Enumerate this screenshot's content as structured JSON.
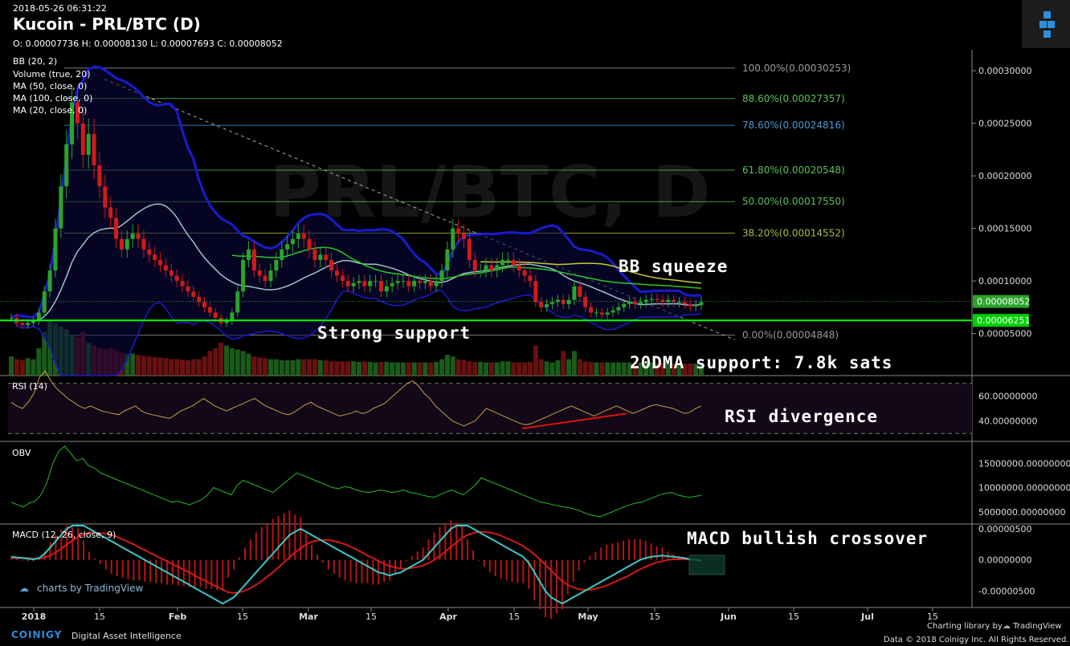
{
  "header": {
    "timestamp": "2018-05-26 06:31:22",
    "title": "Kucoin - PRL/BTC (D)",
    "ohlc": "O: 0.00007736 H: 0.00008130 L: 0.00007693 C: 0.00008052"
  },
  "indicators": [
    "BB (20, 2)",
    "Volume (true, 20)",
    "MA (50, close, 0)",
    "MA (100, close, 0)",
    "MA (20, close, 0)"
  ],
  "watermark": "PRL/BTC, D",
  "annotations": {
    "bb_squeeze": "BB squeeze",
    "strong_support": "Strong support",
    "dma_support": "20DMA support: 7.8k sats",
    "rsi_divergence": "RSI divergence",
    "macd_crossover": "MACD bullish crossover"
  },
  "footer": {
    "tv_badge": "charts by TradingView",
    "coinigy": "COINIGY",
    "coinigy_tag": "Digital Asset Intelligence",
    "charting_lib": "Charting library by",
    "tradingview": "TradingView",
    "copyright": "Data © 2018 Coinigy Inc. All Rights Reserved."
  },
  "colors": {
    "up": "#2aa52a",
    "down": "#d21a1a",
    "bb": "#1a1ad0",
    "ma20": "#9fc3c8",
    "ma50": "#2ac82a",
    "ma100": "#c8c83a",
    "support": "#00ff00",
    "rsi": "#c8a040",
    "obv": "#2ab82a",
    "macd": "#3ac8c8",
    "signal": "#d21a1a"
  },
  "chart_data": [
    {
      "type": "candlestick",
      "panel": "price",
      "x_ticks": [
        "2018",
        "15",
        "Feb",
        "15",
        "Mar",
        "15",
        "Apr",
        "15",
        "May",
        "15",
        "Jun",
        "15",
        "Jul",
        "15"
      ],
      "ylim": [
        1e-05,
        0.00032
      ],
      "y_ticks": [
        "0.00005000",
        "0.00010000",
        "0.00015000",
        "0.00020000",
        "0.00025000",
        "0.00030000"
      ],
      "last_close_label": "0.00008052",
      "last_close": 8.052e-05,
      "support_label": "0.00006251",
      "support": 6.251e-05,
      "fib_levels": [
        {
          "label": "100.00%(0.00030253)",
          "value": 0.00030253
        },
        {
          "label": "88.60%(0.00027357)",
          "value": 0.00027357
        },
        {
          "label": "78.60%(0.00024816)",
          "value": 0.00024816
        },
        {
          "label": "61.80%(0.00020548)",
          "value": 0.00020548
        },
        {
          "label": "50.00%(0.00017550)",
          "value": 0.0001755
        },
        {
          "label": "38.20%(0.00014552)",
          "value": 0.00014552
        },
        {
          "label": "0.00%(0.00004848)",
          "value": 4.848e-05
        }
      ],
      "close": [
        6.5e-05,
        6e-05,
        5.8e-05,
        6e-05,
        6.2e-05,
        7e-05,
        9e-05,
        0.00011,
        0.00015,
        0.00019,
        0.00023,
        0.00027,
        0.00025,
        0.00022,
        0.00024,
        0.00021,
        0.00019,
        0.00017,
        0.00016,
        0.00014,
        0.00013,
        0.00014,
        0.000145,
        0.00014,
        0.00013,
        0.000125,
        0.00012,
        0.000115,
        0.00011,
        0.000105,
        0.0001,
        9.5e-05,
        9e-05,
        8.5e-05,
        8e-05,
        7.5e-05,
        7e-05,
        6.5e-05,
        6e-05,
        6.2e-05,
        7e-05,
        9e-05,
        0.00012,
        0.00013,
        0.00011,
        0.000105,
        0.0001,
        0.00011,
        0.00012,
        0.00013,
        0.000135,
        0.00014,
        0.000145,
        0.00014,
        0.00013,
        0.00012,
        0.000125,
        0.00012,
        0.00011,
        0.000105,
        0.0001,
        9.5e-05,
        9.8e-05,
        0.0001,
        9.5e-05,
        0.0001,
        0.0001,
        9e-05,
        9.5e-05,
        9.8e-05,
        0.0001,
        0.0001,
        9.5e-05,
        0.0001,
        9.8e-05,
        0.0001,
        9.5e-05,
        0.0001,
        0.00011,
        0.00013,
        0.00015,
        0.000145,
        0.00014,
        0.00012,
        0.00011,
        0.00011,
        0.000115,
        0.00011,
        0.000115,
        0.00012,
        0.00012,
        0.000115,
        0.00011,
        0.000105,
        0.0001,
        8e-05,
        7.5e-05,
        7.8e-05,
        8e-05,
        8.2e-05,
        7.8e-05,
        8.2e-05,
        9.5e-05,
        8.5e-05,
        7.5e-05,
        7e-05,
        7e-05,
        6.8e-05,
        7e-05,
        7.2e-05,
        7.5e-05,
        7.8e-05,
        8e-05,
        7.8e-05,
        8e-05,
        8.2e-05,
        8.3e-05,
        8.2e-05,
        8e-05,
        8.2e-05,
        8e-05,
        8e-05,
        7.8e-05,
        7.6e-05,
        7.7e-05,
        8e-05
      ]
    },
    {
      "type": "bar",
      "panel": "volume",
      "values": [
        0.35,
        0.3,
        0.28,
        0.32,
        0.3,
        0.5,
        0.8,
        1,
        0.95,
        0.9,
        0.85,
        0.75,
        0.7,
        0.8,
        0.6,
        0.55,
        0.5,
        0.48,
        0.5,
        0.45,
        0.42,
        0.4,
        0.4,
        0.38,
        0.36,
        0.35,
        0.34,
        0.33,
        0.32,
        0.3,
        0.3,
        0.29,
        0.28,
        0.3,
        0.3,
        0.35,
        0.45,
        0.5,
        0.6,
        0.55,
        0.5,
        0.48,
        0.45,
        0.4,
        0.35,
        0.33,
        0.32,
        0.3,
        0.3,
        0.28,
        0.28,
        0.28,
        0.3,
        0.3,
        0.3,
        0.3,
        0.28,
        0.28,
        0.26,
        0.26,
        0.26,
        0.26,
        0.26,
        0.25,
        0.26,
        0.25,
        0.24,
        0.25,
        0.25,
        0.24,
        0.24,
        0.24,
        0.24,
        0.24,
        0.24,
        0.24,
        0.24,
        0.25,
        0.3,
        0.38,
        0.35,
        0.3,
        0.28,
        0.26,
        0.25,
        0.25,
        0.24,
        0.24,
        0.24,
        0.26,
        0.26,
        0.24,
        0.24,
        0.24,
        0.25,
        0.55,
        0.3,
        0.26,
        0.24,
        0.28,
        0.45,
        0.3,
        0.45,
        0.3,
        0.26,
        0.25,
        0.24,
        0.24,
        0.24,
        0.24,
        0.24,
        0.24,
        0.24,
        0.24,
        0.24,
        0.24,
        0.24,
        0.22,
        0.22,
        0.22,
        0.22,
        0.22,
        0.22,
        0.22,
        0.22,
        0.22
      ]
    },
    {
      "type": "line",
      "panel": "rsi",
      "title": "RSI (14)",
      "y_ticks": [
        "60.00000000",
        "40.00000000"
      ],
      "ylim": [
        25,
        75
      ],
      "values": [
        55,
        52,
        50,
        55,
        62,
        75,
        80,
        72,
        66,
        62,
        58,
        55,
        52,
        50,
        52,
        50,
        48,
        47,
        46,
        45,
        48,
        50,
        52,
        48,
        46,
        45,
        44,
        43,
        42,
        45,
        48,
        50,
        52,
        55,
        58,
        55,
        52,
        50,
        48,
        50,
        52,
        54,
        56,
        58,
        55,
        52,
        50,
        48,
        46,
        45,
        47,
        50,
        53,
        55,
        52,
        50,
        48,
        46,
        44,
        45,
        46,
        48,
        46,
        47,
        50,
        52,
        54,
        58,
        62,
        66,
        70,
        72,
        68,
        62,
        58,
        52,
        48,
        44,
        40,
        38,
        36,
        38,
        40,
        45,
        50,
        48,
        46,
        44,
        42,
        40,
        38,
        37,
        38,
        40,
        42,
        44,
        46,
        48,
        50,
        52,
        50,
        48,
        46,
        44,
        46,
        48,
        50,
        52,
        50,
        48,
        46,
        48,
        50,
        52,
        53,
        52,
        51,
        50,
        48,
        46,
        47,
        50,
        52
      ]
    },
    {
      "type": "line",
      "panel": "obv",
      "title": "OBV",
      "y_ticks": [
        "15000000.00000000",
        "10000000.00000000",
        "5000000.00000000"
      ],
      "ylim": [
        3000000,
        19000000
      ],
      "values": [
        7000000,
        6500000,
        6000000,
        6800000,
        7200000,
        8500000,
        11000000,
        15000000,
        17500000,
        18500000,
        17000000,
        15500000,
        16000000,
        14500000,
        14000000,
        13000000,
        12500000,
        12000000,
        11500000,
        11000000,
        10500000,
        10000000,
        9500000,
        9000000,
        8500000,
        8000000,
        7500000,
        7000000,
        7200000,
        6800000,
        6500000,
        7000000,
        7500000,
        8500000,
        10000000,
        9500000,
        9000000,
        8500000,
        10500000,
        11500000,
        11000000,
        10500000,
        10000000,
        9500000,
        9000000,
        10000000,
        11000000,
        12000000,
        13000000,
        12500000,
        12000000,
        11500000,
        11000000,
        10500000,
        10000000,
        9800000,
        10200000,
        10000000,
        9500000,
        9200000,
        9000000,
        9200000,
        9500000,
        9300000,
        9000000,
        9200000,
        9500000,
        9000000,
        8800000,
        8500000,
        8200000,
        8000000,
        8500000,
        9000000,
        9500000,
        9000000,
        8500000,
        9500000,
        10500000,
        12000000,
        11500000,
        11000000,
        10500000,
        10000000,
        9500000,
        9000000,
        8500000,
        8000000,
        7500000,
        7000000,
        6800000,
        6500000,
        6200000,
        6000000,
        5800000,
        5500000,
        5000000,
        4500000,
        4200000,
        4000000,
        4500000,
        5000000,
        5500000,
        6000000,
        6500000,
        6800000,
        7000000,
        7500000,
        8000000,
        8500000,
        8800000,
        9000000,
        8500000,
        8200000,
        8000000,
        8200000,
        8400000
      ]
    },
    {
      "type": "line",
      "panel": "macd",
      "title": "MACD (12, 26, close, 9)",
      "y_ticks": [
        "0.00000500",
        "0.00000000",
        "-0.00000500"
      ],
      "ylim": [
        -7.5e-06,
        5.5e-06
      ],
      "series": [
        {
          "values": [
            5e-07,
            4e-07,
            3e-07,
            2e-07,
            1e-07,
            3e-07,
            1e-06,
            2e-06,
            3e-06,
            4e-06,
            5e-06,
            5.5e-06,
            6e-06,
            5.5e-06,
            5e-06,
            4.5e-06,
            4e-06,
            3.5e-06,
            3e-06,
            2.5e-06,
            2e-06,
            1.5e-06,
            1e-06,
            5e-07,
            0,
            -5e-07,
            -1e-06,
            -1.5e-06,
            -2e-06,
            -2.5e-06,
            -3e-06,
            -3.5e-06,
            -4e-06,
            -4.5e-06,
            -5e-06,
            -5.5e-06,
            -6e-06,
            -6.5e-06,
            -7e-06,
            -6.5e-06,
            -6e-06,
            -5e-06,
            -4e-06,
            -3e-06,
            -2e-06,
            -1e-06,
            0,
            1e-06,
            2e-06,
            3e-06,
            4e-06,
            4.5e-06,
            5e-06,
            4.5e-06,
            4e-06,
            3.5e-06,
            3e-06,
            2.5e-06,
            2e-06,
            1.5e-06,
            1e-06,
            5e-07,
            0,
            -5e-07,
            -1e-06,
            -1.5e-06,
            -2e-06,
            -2.2e-06,
            -2.5e-06,
            -2.2e-06,
            -2e-06,
            -1.5e-06,
            -1e-06,
            -5e-07,
            0,
            1e-06,
            2e-06,
            3e-06,
            4e-06,
            5e-06,
            5.5e-06,
            6e-06,
            5.5e-06,
            5e-06,
            4.5e-06,
            4e-06,
            3.5e-06,
            3e-06,
            2.5e-06,
            2e-06,
            1.5e-06,
            1e-06,
            5e-07,
            -5e-07,
            -2e-06,
            -3.5e-06,
            -5e-06,
            -6e-06,
            -6.5e-06,
            -7e-06,
            -6.5e-06,
            -6e-06,
            -5.5e-06,
            -5e-06,
            -4.5e-06,
            -4e-06,
            -3.5e-06,
            -3e-06,
            -2.5e-06,
            -2e-06,
            -1.5e-06,
            -1e-06,
            -5e-07,
            0,
            3e-07,
            5e-07,
            6e-07,
            7e-07,
            6e-07,
            5e-07,
            4e-07,
            3e-07,
            1e-07,
            0,
            -1e-07
          ]
        },
        {
          "values": [
            3e-07,
            3e-07,
            3e-07,
            3e-07,
            2e-07,
            2e-07,
            4e-07,
            7e-07,
            1.2e-06,
            1.8e-06,
            2.5e-06,
            3.1e-06,
            3.7e-06,
            4.1e-06,
            4.4e-06,
            4.4e-06,
            4.3e-06,
            4.2e-06,
            4e-06,
            3.7e-06,
            3.3e-06,
            2.9e-06,
            2.5e-06,
            2e-06,
            1.6e-06,
            1.1e-06,
            7e-07,
            2e-07,
            -2e-07,
            -7e-07,
            -1.1e-06,
            -1.6e-06,
            -2e-06,
            -2.5e-06,
            -3e-06,
            -3.4e-06,
            -3.9e-06,
            -4.3e-06,
            -4.8e-06,
            -5.2e-06,
            -5.3e-06,
            -5.2e-06,
            -4.9e-06,
            -4.5e-06,
            -4e-06,
            -3.4e-06,
            -2.7e-06,
            -2e-06,
            -1.2e-06,
            -4e-07,
            4e-07,
            1.2e-06,
            1.9e-06,
            2.5e-06,
            2.9e-06,
            3.1e-06,
            3.2e-06,
            3.2e-06,
            3e-06,
            2.8e-06,
            2.5e-06,
            2.1e-06,
            1.7e-06,
            1.2e-06,
            7e-07,
            3e-07,
            -2e-07,
            -6e-07,
            -1e-06,
            -1.2e-06,
            -1.4e-06,
            -1.4e-06,
            -1.3e-06,
            -1.1e-06,
            -9e-07,
            -5e-07,
            0,
            6e-07,
            1.3e-06,
            2.1e-06,
            2.8e-06,
            3.5e-06,
            4e-06,
            4.3e-06,
            4.5e-06,
            4.5e-06,
            4.4e-06,
            4.2e-06,
            3.9e-06,
            3.5e-06,
            3.1e-06,
            2.7e-06,
            2.2e-06,
            1.6e-06,
            9e-07,
            1e-07,
            -8e-07,
            -1.7e-06,
            -2.6e-06,
            -3.4e-06,
            -4e-06,
            -4.4e-06,
            -4.7e-06,
            -4.8e-06,
            -4.8e-06,
            -4.6e-06,
            -4.4e-06,
            -4.1e-06,
            -3.7e-06,
            -3.3e-06,
            -2.9e-06,
            -2.5e-06,
            -2e-06,
            -1.5e-06,
            -1.1e-06,
            -7e-07,
            -4e-07,
            -2e-07,
            0,
            1e-07,
            1e-07,
            1e-07,
            1e-07,
            0,
            0
          ]
        }
      ]
    }
  ]
}
